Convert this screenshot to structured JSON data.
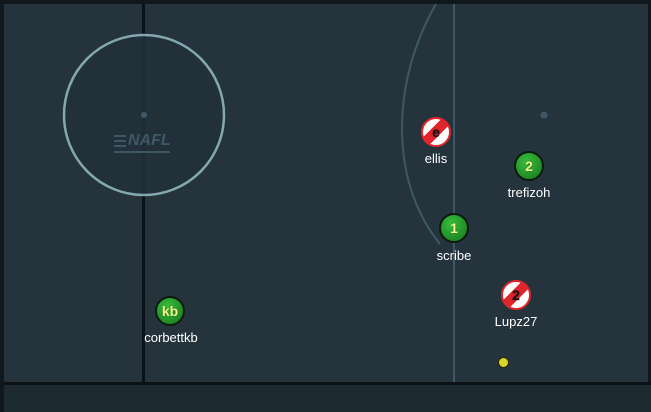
{
  "logo": {
    "text": "NAFL"
  },
  "players": [
    {
      "id": "ellis",
      "name": "ellis",
      "label": "e",
      "team": "red"
    },
    {
      "id": "trefizoh",
      "name": "trefizoh",
      "label": "2",
      "team": "green"
    },
    {
      "id": "scribe",
      "name": "scribe",
      "label": "1",
      "team": "green"
    },
    {
      "id": "lupz27",
      "name": "Lupz27",
      "label": "2",
      "team": "red"
    },
    {
      "id": "corbettkb",
      "name": "corbettkb",
      "label": "kb",
      "team": "green"
    }
  ],
  "colors": {
    "field": "#25333d",
    "lines": "#3f5868",
    "center_circle": "#8fb5bd",
    "team_green": "#2aa82f",
    "team_red": "#e0262b",
    "ball": "#d8d82a"
  }
}
